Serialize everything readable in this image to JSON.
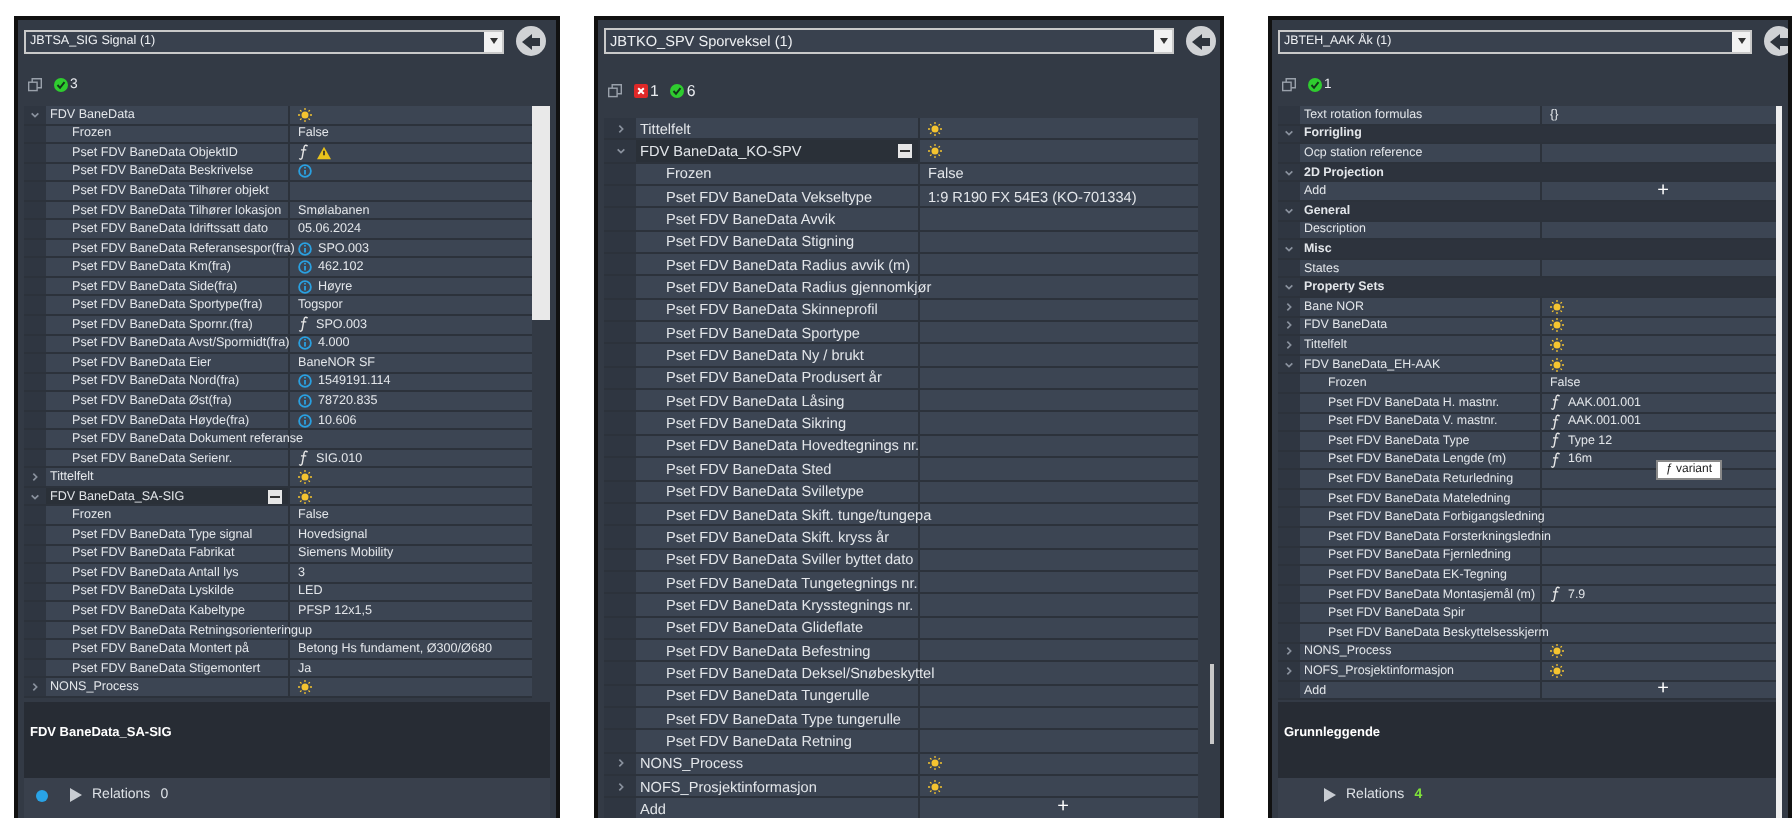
{
  "panels": [
    {
      "title": "JBTSA_SIG Signal (1)",
      "counters": [
        {
          "kind": "ok",
          "count": "3"
        }
      ],
      "rows": [
        {
          "kind": "group",
          "label": "FDV BaneData",
          "expanded": true,
          "selected": false,
          "children": [
            {
              "kind": "prop",
              "label": "Frozen",
              "value": {
                "kind": "plain",
                "text": "False"
              }
            },
            {
              "kind": "prop",
              "label": "Pset FDV BaneData ObjektID",
              "value": {
                "kind": "formula-warning"
              }
            },
            {
              "kind": "prop",
              "label": "Pset FDV BaneData Beskrivelse",
              "value": {
                "kind": "info"
              }
            },
            {
              "kind": "prop",
              "label": "Pset FDV BaneData Tilhører objekt"
            },
            {
              "kind": "prop",
              "label": "Pset FDV BaneData Tilhører lokasjon",
              "value": {
                "kind": "plain",
                "text": "Smølabanen"
              }
            },
            {
              "kind": "prop",
              "label": "Pset FDV BaneData Idriftssatt dato",
              "value": {
                "kind": "plain",
                "text": "05.06.2024"
              }
            },
            {
              "kind": "prop",
              "label": "Pset FDV BaneData Referansespor(fra)",
              "value": {
                "kind": "info",
                "text": "SPO.003"
              }
            },
            {
              "kind": "prop",
              "label": "Pset FDV BaneData Km(fra)",
              "value": {
                "kind": "info",
                "text": "462.102"
              }
            },
            {
              "kind": "prop",
              "label": "Pset FDV BaneData Side(fra)",
              "value": {
                "kind": "info",
                "text": "Høyre"
              }
            },
            {
              "kind": "prop",
              "label": "Pset FDV BaneData Sportype(fra)",
              "value": {
                "kind": "plain",
                "text": "Togspor"
              }
            },
            {
              "kind": "prop",
              "label": "Pset FDV BaneData Spornr.(fra)",
              "value": {
                "kind": "formula",
                "text": "SPO.003"
              }
            },
            {
              "kind": "prop",
              "label": "Pset FDV BaneData Avst/Spormidt(fra)",
              "value": {
                "kind": "info",
                "text": "4.000"
              }
            },
            {
              "kind": "prop",
              "label": "Pset FDV BaneData Eier",
              "value": {
                "kind": "plain",
                "text": "BaneNOR SF"
              }
            },
            {
              "kind": "prop",
              "label": "Pset FDV BaneData Nord(fra)",
              "value": {
                "kind": "info",
                "text": "1549191.114"
              }
            },
            {
              "kind": "prop",
              "label": "Pset FDV BaneData Øst(fra)",
              "value": {
                "kind": "info",
                "text": "78720.835"
              }
            },
            {
              "kind": "prop",
              "label": "Pset FDV BaneData Høyde(fra)",
              "value": {
                "kind": "info",
                "text": "10.606"
              }
            },
            {
              "kind": "prop",
              "label": "Pset FDV BaneData Dokument referanse"
            },
            {
              "kind": "prop",
              "label": "Pset FDV BaneData Serienr.",
              "value": {
                "kind": "formula",
                "text": "SIG.010"
              }
            }
          ]
        },
        {
          "kind": "group",
          "label": "Tittelfelt",
          "expanded": false,
          "selected": false
        },
        {
          "kind": "group",
          "label": "FDV BaneData_SA-SIG",
          "expanded": true,
          "selected": true,
          "children": [
            {
              "kind": "prop",
              "label": "Frozen",
              "value": {
                "kind": "plain",
                "text": "False"
              }
            },
            {
              "kind": "prop",
              "label": "Pset FDV BaneData Type signal",
              "value": {
                "kind": "plain",
                "text": "Hovedsignal"
              }
            },
            {
              "kind": "prop",
              "label": "Pset FDV BaneData Fabrikat",
              "value": {
                "kind": "plain",
                "text": "Siemens Mobility"
              }
            },
            {
              "kind": "prop",
              "label": "Pset FDV BaneData Antall lys",
              "value": {
                "kind": "plain",
                "text": "3"
              }
            },
            {
              "kind": "prop",
              "label": "Pset FDV BaneData Lyskilde",
              "value": {
                "kind": "plain",
                "text": "LED"
              }
            },
            {
              "kind": "prop",
              "label": "Pset FDV BaneData Kabeltype",
              "value": {
                "kind": "plain",
                "text": "PFSP 12x1,5"
              }
            },
            {
              "kind": "prop",
              "label": "Pset FDV BaneData Retningsorientering",
              "value": {
                "kind": "plain",
                "text": "up"
              }
            },
            {
              "kind": "prop",
              "label": "Pset FDV BaneData Montert på",
              "value": {
                "kind": "plain",
                "text": "Betong Hs fundament, Ø300/Ø680"
              }
            },
            {
              "kind": "prop",
              "label": "Pset FDV BaneData Stigemontert",
              "value": {
                "kind": "plain",
                "text": "Ja"
              }
            }
          ]
        },
        {
          "kind": "group",
          "label": "NONS_Process",
          "expanded": false,
          "selected": false
        }
      ],
      "description": "FDV BaneData_SA-SIG",
      "footer": {
        "label": "Relations",
        "count": "0",
        "dot": true,
        "highlighted": false
      }
    },
    {
      "title": "JBTKO_SPV Sporveksel (1)",
      "counters": [
        {
          "kind": "error",
          "count": "1"
        },
        {
          "kind": "ok",
          "count": "6"
        }
      ],
      "rows": [
        {
          "kind": "group",
          "label": "Tittelfelt",
          "expanded": false,
          "selected": false
        },
        {
          "kind": "group",
          "label": "FDV BaneData_KO-SPV",
          "expanded": true,
          "selected": true,
          "children": [
            {
              "kind": "prop",
              "label": "Frozen",
              "value": {
                "kind": "plain",
                "text": "False"
              }
            },
            {
              "kind": "prop",
              "label": "Pset FDV BaneData Vekseltype",
              "value": {
                "kind": "plain",
                "text": "1:9 R190 FX 54E3 (KO-701334)"
              }
            },
            {
              "kind": "prop",
              "label": "Pset FDV BaneData Avvik"
            },
            {
              "kind": "prop",
              "label": "Pset FDV BaneData Stigning"
            },
            {
              "kind": "prop",
              "label": "Pset FDV BaneData Radius avvik (m)"
            },
            {
              "kind": "prop",
              "label": "Pset FDV BaneData Radius gjennomkjør"
            },
            {
              "kind": "prop",
              "label": "Pset FDV BaneData Skinneprofil"
            },
            {
              "kind": "prop",
              "label": "Pset FDV BaneData Sportype"
            },
            {
              "kind": "prop",
              "label": "Pset FDV BaneData Ny / brukt"
            },
            {
              "kind": "prop",
              "label": "Pset FDV BaneData Produsert år"
            },
            {
              "kind": "prop",
              "label": "Pset FDV BaneData Låsing"
            },
            {
              "kind": "prop",
              "label": "Pset FDV BaneData Sikring"
            },
            {
              "kind": "prop",
              "label": "Pset FDV BaneData Hovedtegnings nr."
            },
            {
              "kind": "prop",
              "label": "Pset FDV BaneData Sted"
            },
            {
              "kind": "prop",
              "label": "Pset FDV BaneData Svilletype"
            },
            {
              "kind": "prop",
              "label": "Pset FDV BaneData Skift. tunge/tungepa"
            },
            {
              "kind": "prop",
              "label": "Pset FDV BaneData Skift. kryss år"
            },
            {
              "kind": "prop",
              "label": "Pset FDV BaneData Sviller byttet dato"
            },
            {
              "kind": "prop",
              "label": "Pset FDV BaneData Tungetegnings nr."
            },
            {
              "kind": "prop",
              "label": "Pset FDV BaneData Krysstegnings nr."
            },
            {
              "kind": "prop",
              "label": "Pset FDV BaneData Glideflate"
            },
            {
              "kind": "prop",
              "label": "Pset FDV BaneData Befestning"
            },
            {
              "kind": "prop",
              "label": "Pset FDV BaneData Deksel/Snøbeskyttel"
            },
            {
              "kind": "prop",
              "label": "Pset FDV BaneData Tungerulle"
            },
            {
              "kind": "prop",
              "label": "Pset FDV BaneData Type tungerulle"
            },
            {
              "kind": "prop",
              "label": "Pset FDV BaneData Retning"
            }
          ]
        },
        {
          "kind": "group",
          "label": "NONS_Process",
          "expanded": false,
          "selected": false
        },
        {
          "kind": "group",
          "label": "NOFS_Prosjektinformasjon",
          "expanded": false,
          "selected": false
        },
        {
          "kind": "add",
          "label": "Add",
          "button": "+"
        }
      ]
    },
    {
      "title": "JBTEH_AAK Åk (1)",
      "counters": [
        {
          "kind": "ok",
          "count": "1"
        }
      ],
      "rows": [
        {
          "kind": "prop",
          "label": "Text rotation formulas",
          "value": {
            "kind": "plain",
            "text": "{}"
          }
        },
        {
          "kind": "section",
          "label": "Forrigling",
          "expanded": true,
          "children": [
            {
              "kind": "prop",
              "label": "Ocp station reference"
            }
          ]
        },
        {
          "kind": "section",
          "label": "2D Projection",
          "expanded": true,
          "children": [
            {
              "kind": "add",
              "label": "Add",
              "button": "+"
            }
          ]
        },
        {
          "kind": "section",
          "label": "General",
          "expanded": true,
          "children": [
            {
              "kind": "prop",
              "label": "Description"
            }
          ]
        },
        {
          "kind": "section",
          "label": "Misc",
          "expanded": true,
          "children": [
            {
              "kind": "prop",
              "label": "States"
            }
          ]
        },
        {
          "kind": "section",
          "label": "Property Sets",
          "expanded": true,
          "children": [
            {
              "kind": "group",
              "label": "Bane NOR",
              "expanded": false,
              "selected": false
            },
            {
              "kind": "group",
              "label": "FDV BaneData",
              "expanded": false,
              "selected": false
            },
            {
              "kind": "group",
              "label": "Tittelfelt",
              "expanded": false,
              "selected": false
            },
            {
              "kind": "group",
              "label": "FDV BaneData_EH-AAK",
              "expanded": true,
              "selected": false,
              "children": [
                {
                  "kind": "prop",
                  "label": "Frozen",
                  "value": {
                    "kind": "plain",
                    "text": "False"
                  }
                },
                {
                  "kind": "prop",
                  "label": "Pset FDV BaneData H. mastnr.",
                  "value": {
                    "kind": "formula",
                    "text": "AAK.001.001"
                  }
                },
                {
                  "kind": "prop",
                  "label": "Pset FDV BaneData V. mastnr.",
                  "value": {
                    "kind": "formula",
                    "text": "AAK.001.001"
                  }
                },
                {
                  "kind": "prop",
                  "label": "Pset FDV BaneData Type",
                  "value": {
                    "kind": "formula",
                    "text": "Type 12"
                  }
                },
                {
                  "kind": "prop",
                  "label": "Pset FDV BaneData Lengde (m)",
                  "value": {
                    "kind": "formula",
                    "text": "16m"
                  },
                  "tooltip": "ƒ variant"
                },
                {
                  "kind": "prop",
                  "label": "Pset FDV BaneData Returledning"
                },
                {
                  "kind": "prop",
                  "label": "Pset FDV BaneData Mateledning"
                },
                {
                  "kind": "prop",
                  "label": "Pset FDV BaneData Forbigangsledning"
                },
                {
                  "kind": "prop",
                  "label": "Pset FDV BaneData Forsterkningslednin"
                },
                {
                  "kind": "prop",
                  "label": "Pset FDV BaneData Fjernledning"
                },
                {
                  "kind": "prop",
                  "label": "Pset FDV BaneData EK-Tegning"
                },
                {
                  "kind": "prop",
                  "label": "Pset FDV BaneData Montasjemål (m)",
                  "value": {
                    "kind": "formula",
                    "text": "7.9"
                  }
                },
                {
                  "kind": "prop",
                  "label": "Pset FDV BaneData Spir"
                },
                {
                  "kind": "prop",
                  "label": "Pset FDV BaneData Beskyttelsesskjerm"
                }
              ]
            },
            {
              "kind": "group",
              "label": "NONS_Process",
              "expanded": false,
              "selected": false
            },
            {
              "kind": "group",
              "label": "NOFS_Prosjektinformasjon",
              "expanded": false,
              "selected": false
            },
            {
              "kind": "add",
              "label": "Add",
              "button": "+"
            }
          ]
        }
      ],
      "description": "Grunnleggende",
      "footer": {
        "label": "Relations",
        "count": "4",
        "highlighted": true
      }
    }
  ]
}
